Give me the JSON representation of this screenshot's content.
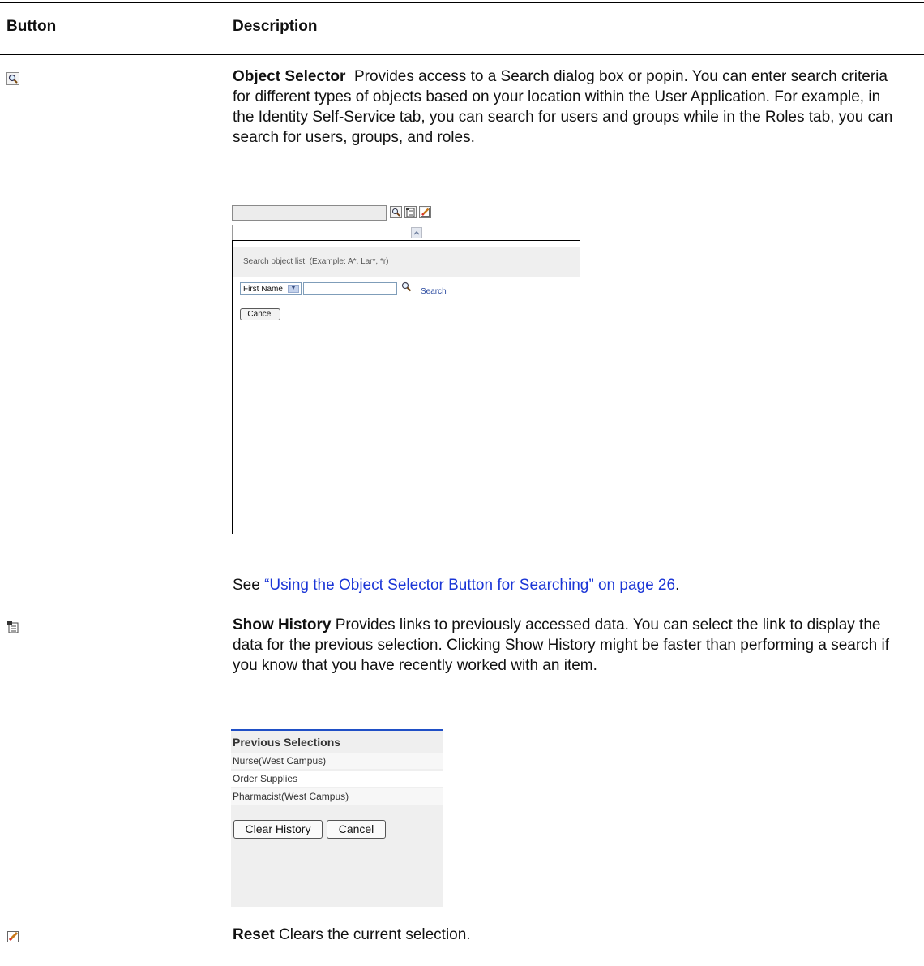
{
  "table": {
    "headers": {
      "button": "Button",
      "description": "Description"
    }
  },
  "rows": {
    "object_selector": {
      "icon": "magnifier-icon",
      "title": "Object Selector",
      "text": "Provides access to a Search dialog box or popin. You can enter search criteria for different types of objects based on your location within the User Application. For example, in the Identity Self-Service tab, you can search for users and groups while in the Roles tab, you can search for users, groups, and roles.",
      "see_prefix": "See ",
      "see_link": "“Using the Object Selector Button for Searching” on page 26",
      "see_suffix": "."
    },
    "show_history": {
      "icon": "history-icon",
      "title": "Show History",
      "text": "Provides links to previously accessed data. You can select the link to display the data for the previous selection. Clicking Show History might be faster than performing a search if you know that you have recently worked with an item."
    },
    "reset": {
      "icon": "reset-icon",
      "title": "Reset",
      "text": "Clears the current selection."
    }
  },
  "object_selector_screenshot": {
    "hint": "Search object list: (Example: A*, Lar*, *r)",
    "field_select": "First Name",
    "search_label": "Search",
    "cancel_label": "Cancel"
  },
  "history_screenshot": {
    "title": "Previous Selections",
    "items": [
      "Nurse(West Campus)",
      "Order Supplies",
      "Pharmacist(West Campus)"
    ],
    "clear_label": "Clear History",
    "cancel_label": "Cancel"
  },
  "colors": {
    "link": "#1a35d6",
    "accent_rule": "#1f4fc6"
  }
}
